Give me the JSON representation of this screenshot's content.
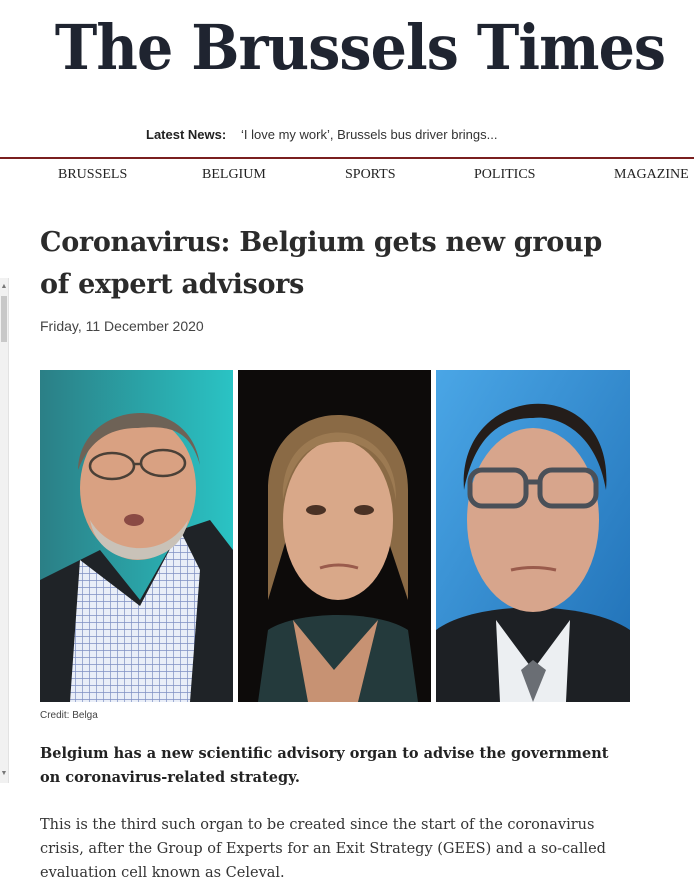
{
  "site": {
    "name": "The Brussels Times"
  },
  "ticker": {
    "label": "Latest News:",
    "headline": "‘I love my work’, Brussels bus driver brings..."
  },
  "nav": {
    "items": [
      {
        "label": "BRUSSELS"
      },
      {
        "label": "BELGIUM"
      },
      {
        "label": "SPORTS"
      },
      {
        "label": "POLITICS"
      },
      {
        "label": "MAGAZINE"
      }
    ]
  },
  "article": {
    "title": "Coronavirus: Belgium gets new group of expert advisors",
    "date": "Friday, 11 December 2020",
    "photo_credit": "Credit: Belga",
    "lead": "Belgium has a new scientific advisory organ to advise the government on coronavirus-related strategy.",
    "paragraph1": "This is the third such organ to be created since the start of the coronavirus crisis, after the Group of Experts for an Exit Strategy (GEES) and a so-called evaluation cell known as Celeval."
  },
  "colors": {
    "masthead": "#1f2430",
    "nav_rule": "#7a1f1f"
  }
}
